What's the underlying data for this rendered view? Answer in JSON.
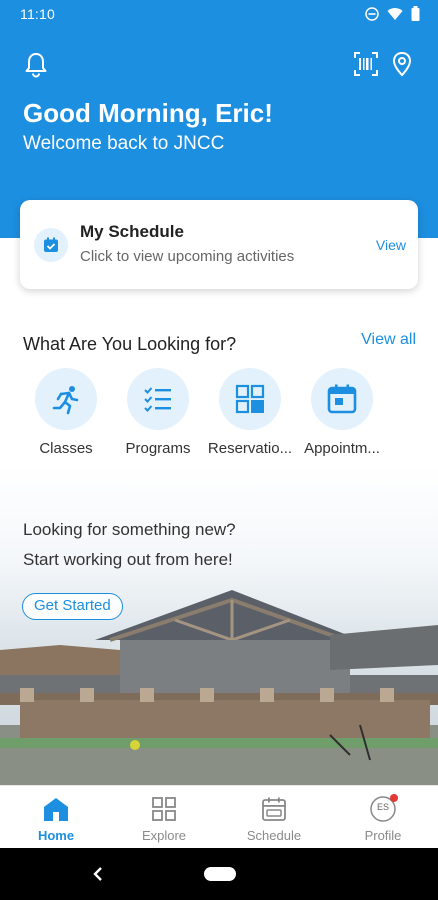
{
  "status": {
    "time": "11:10"
  },
  "header": {
    "greeting": "Good Morning, Eric!",
    "welcome": "Welcome back to JNCC"
  },
  "schedule_card": {
    "title": "My Schedule",
    "subtitle": "Click to view upcoming activities",
    "view_label": "View"
  },
  "categories": {
    "title": "What Are You Looking for?",
    "view_all": "View all",
    "items": [
      {
        "label": "Classes",
        "icon": "running-person-icon"
      },
      {
        "label": "Programs",
        "icon": "checklist-icon"
      },
      {
        "label": "Reservatio...",
        "icon": "grid-icon"
      },
      {
        "label": "Appointm...",
        "icon": "calendar-icon"
      }
    ]
  },
  "promo": {
    "line1": "Looking for something new?",
    "line2": "Start working out from here!",
    "button": "Get Started"
  },
  "tabbar": {
    "items": [
      {
        "label": "Home",
        "active": true
      },
      {
        "label": "Explore",
        "active": false
      },
      {
        "label": "Schedule",
        "active": false
      },
      {
        "label": "Profile",
        "active": false,
        "initials": "ES"
      }
    ]
  },
  "colors": {
    "accent": "#1d8fe0",
    "accent_light": "#e3f1fc",
    "badge": "#e53935"
  }
}
